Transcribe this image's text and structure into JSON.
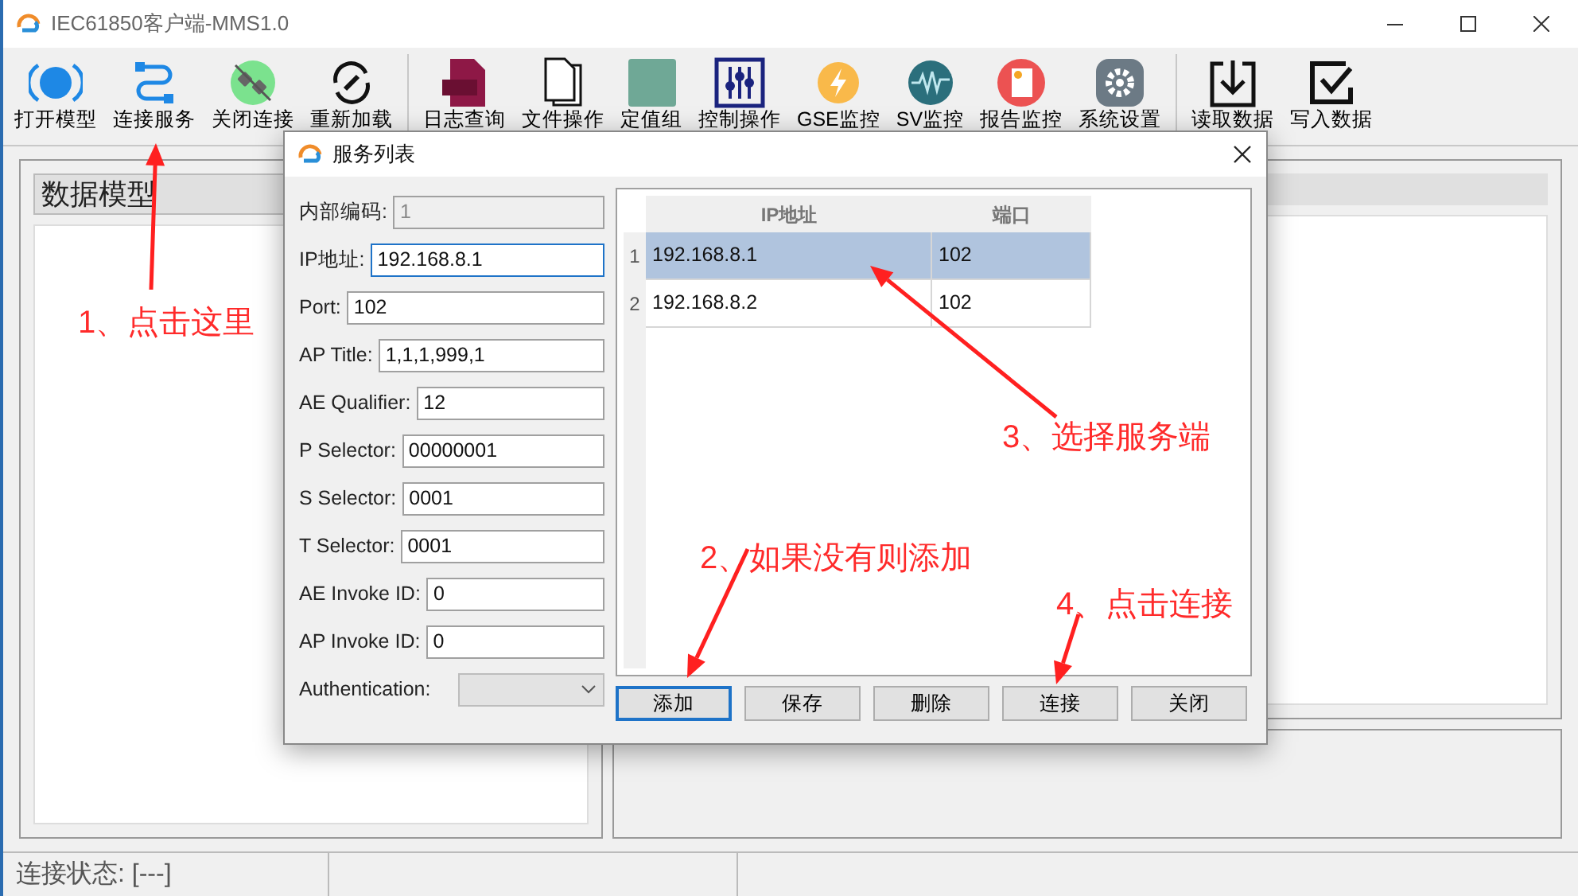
{
  "window": {
    "title": "IEC61850客户端-MMS1.0"
  },
  "toolbar": [
    {
      "label": "打开模型"
    },
    {
      "label": "连接服务"
    },
    {
      "label": "关闭连接"
    },
    {
      "label": "重新加载"
    },
    {
      "label": "日志查询"
    },
    {
      "label": "文件操作"
    },
    {
      "label": "定值组"
    },
    {
      "label": "控制操作"
    },
    {
      "label": "GSE监控"
    },
    {
      "label": "SV监控"
    },
    {
      "label": "报告监控"
    },
    {
      "label": "系统设置"
    },
    {
      "label": "读取数据"
    },
    {
      "label": "写入数据"
    }
  ],
  "data_model_panel": {
    "title": "数据模型"
  },
  "status_bar": {
    "connection": "连接状态: [---]"
  },
  "dialog": {
    "title": "服务列表",
    "fields": [
      {
        "kind": "text",
        "label": "内部编码:",
        "value": "1",
        "disabled": true,
        "focused": false
      },
      {
        "kind": "text",
        "label": "IP地址:",
        "value": "192.168.8.1",
        "disabled": false,
        "focused": true
      },
      {
        "kind": "text",
        "label": "Port:",
        "value": "102",
        "disabled": false,
        "focused": false
      },
      {
        "kind": "text",
        "label": "AP Title:",
        "value": "1,1,1,999,1",
        "disabled": false,
        "focused": false
      },
      {
        "kind": "text",
        "label": "AE Qualifier:",
        "value": "12",
        "disabled": false,
        "focused": false
      },
      {
        "kind": "text",
        "label": "P Selector:",
        "value": "00000001",
        "disabled": false,
        "focused": false
      },
      {
        "kind": "text",
        "label": "S Selector:",
        "value": "0001",
        "disabled": false,
        "focused": false
      },
      {
        "kind": "text",
        "label": "T Selector:",
        "value": "0001",
        "disabled": false,
        "focused": false
      },
      {
        "kind": "text",
        "label": "AE Invoke ID:",
        "value": "0",
        "disabled": false,
        "focused": false
      },
      {
        "kind": "text",
        "label": "AP Invoke ID:",
        "value": "0",
        "disabled": false,
        "focused": false
      },
      {
        "kind": "select",
        "label": "Authentication:",
        "disabled": false,
        "focused": false
      }
    ],
    "table": {
      "columns": [
        "IP地址",
        "端口"
      ],
      "rows": [
        {
          "index": "1",
          "cells": [
            "192.168.8.1",
            "102"
          ],
          "selected": true
        },
        {
          "index": "2",
          "cells": [
            "192.168.8.2",
            "102"
          ],
          "selected": false
        }
      ]
    },
    "buttons": [
      {
        "label": "添加",
        "focused": true
      },
      {
        "label": "保存",
        "focused": false
      },
      {
        "label": "删除",
        "focused": false
      },
      {
        "label": "连接",
        "focused": false
      },
      {
        "label": "关闭",
        "focused": false
      }
    ]
  },
  "annotations": [
    {
      "text": "1、点击这里"
    },
    {
      "text": "2、如果没有则添加"
    },
    {
      "text": "3、选择服务端"
    },
    {
      "text": "4、点击连接"
    }
  ]
}
